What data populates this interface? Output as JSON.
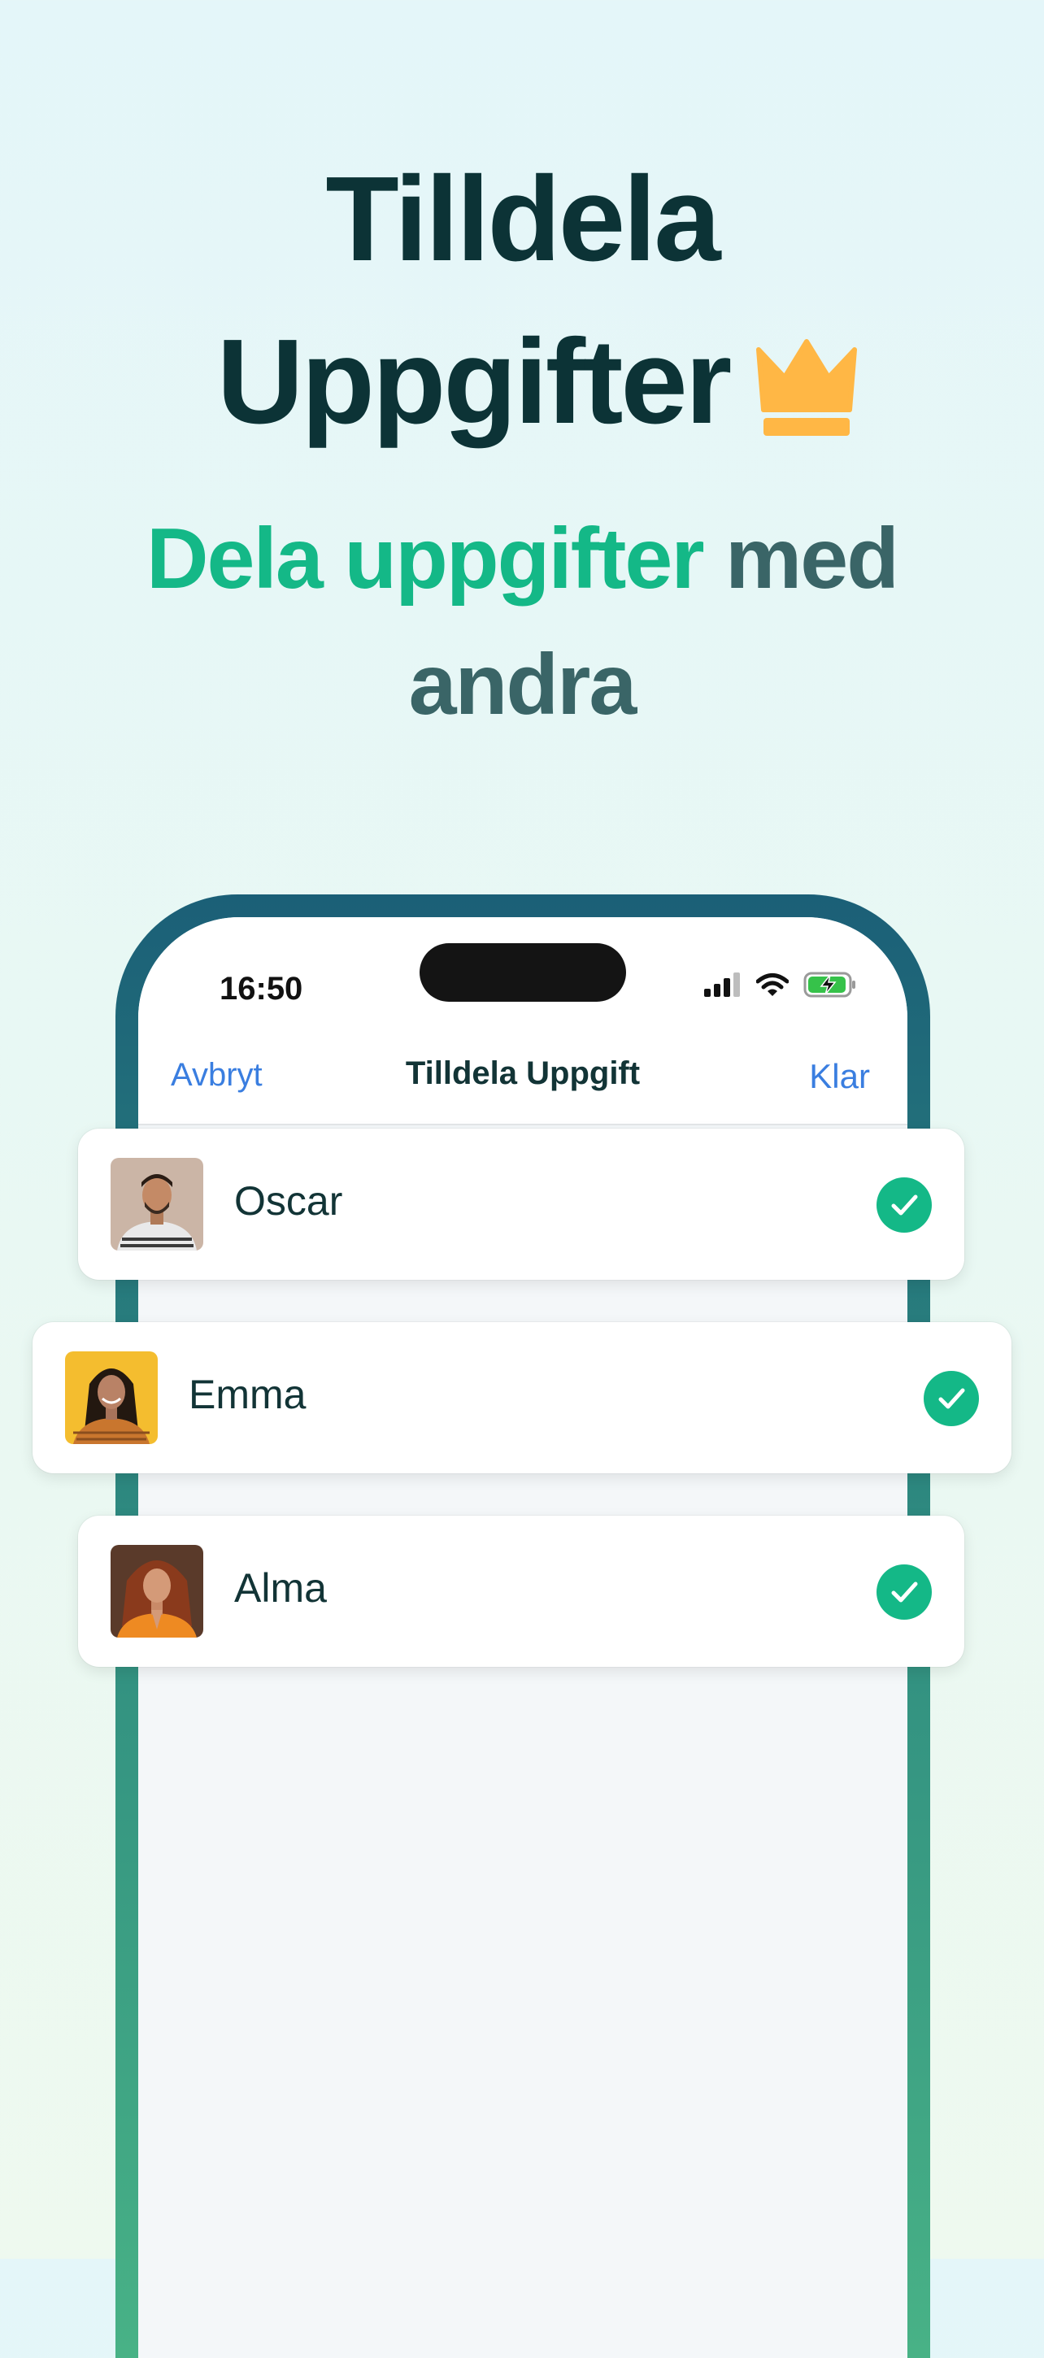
{
  "hero": {
    "title_line1": "Tilldela",
    "title_line2": "Uppgifter",
    "crown_icon": "crown-icon",
    "subtitle_accent": "Dela uppgifter",
    "subtitle_rest_line1": " med",
    "subtitle_line2": "andra"
  },
  "colors": {
    "accent": "#14b887",
    "title": "#0c3336",
    "link": "#3a7ee0",
    "crown": "#ffb745"
  },
  "status_bar": {
    "time": "16:50",
    "icons": [
      "cellular-signal-icon",
      "wifi-icon",
      "battery-charging-icon"
    ]
  },
  "nav": {
    "cancel": "Avbryt",
    "title": "Tilldela Uppgift",
    "done": "Klar"
  },
  "assignees": [
    {
      "name": "Oscar",
      "selected": true
    },
    {
      "name": "Emma",
      "selected": true
    },
    {
      "name": "Alma",
      "selected": true
    }
  ]
}
